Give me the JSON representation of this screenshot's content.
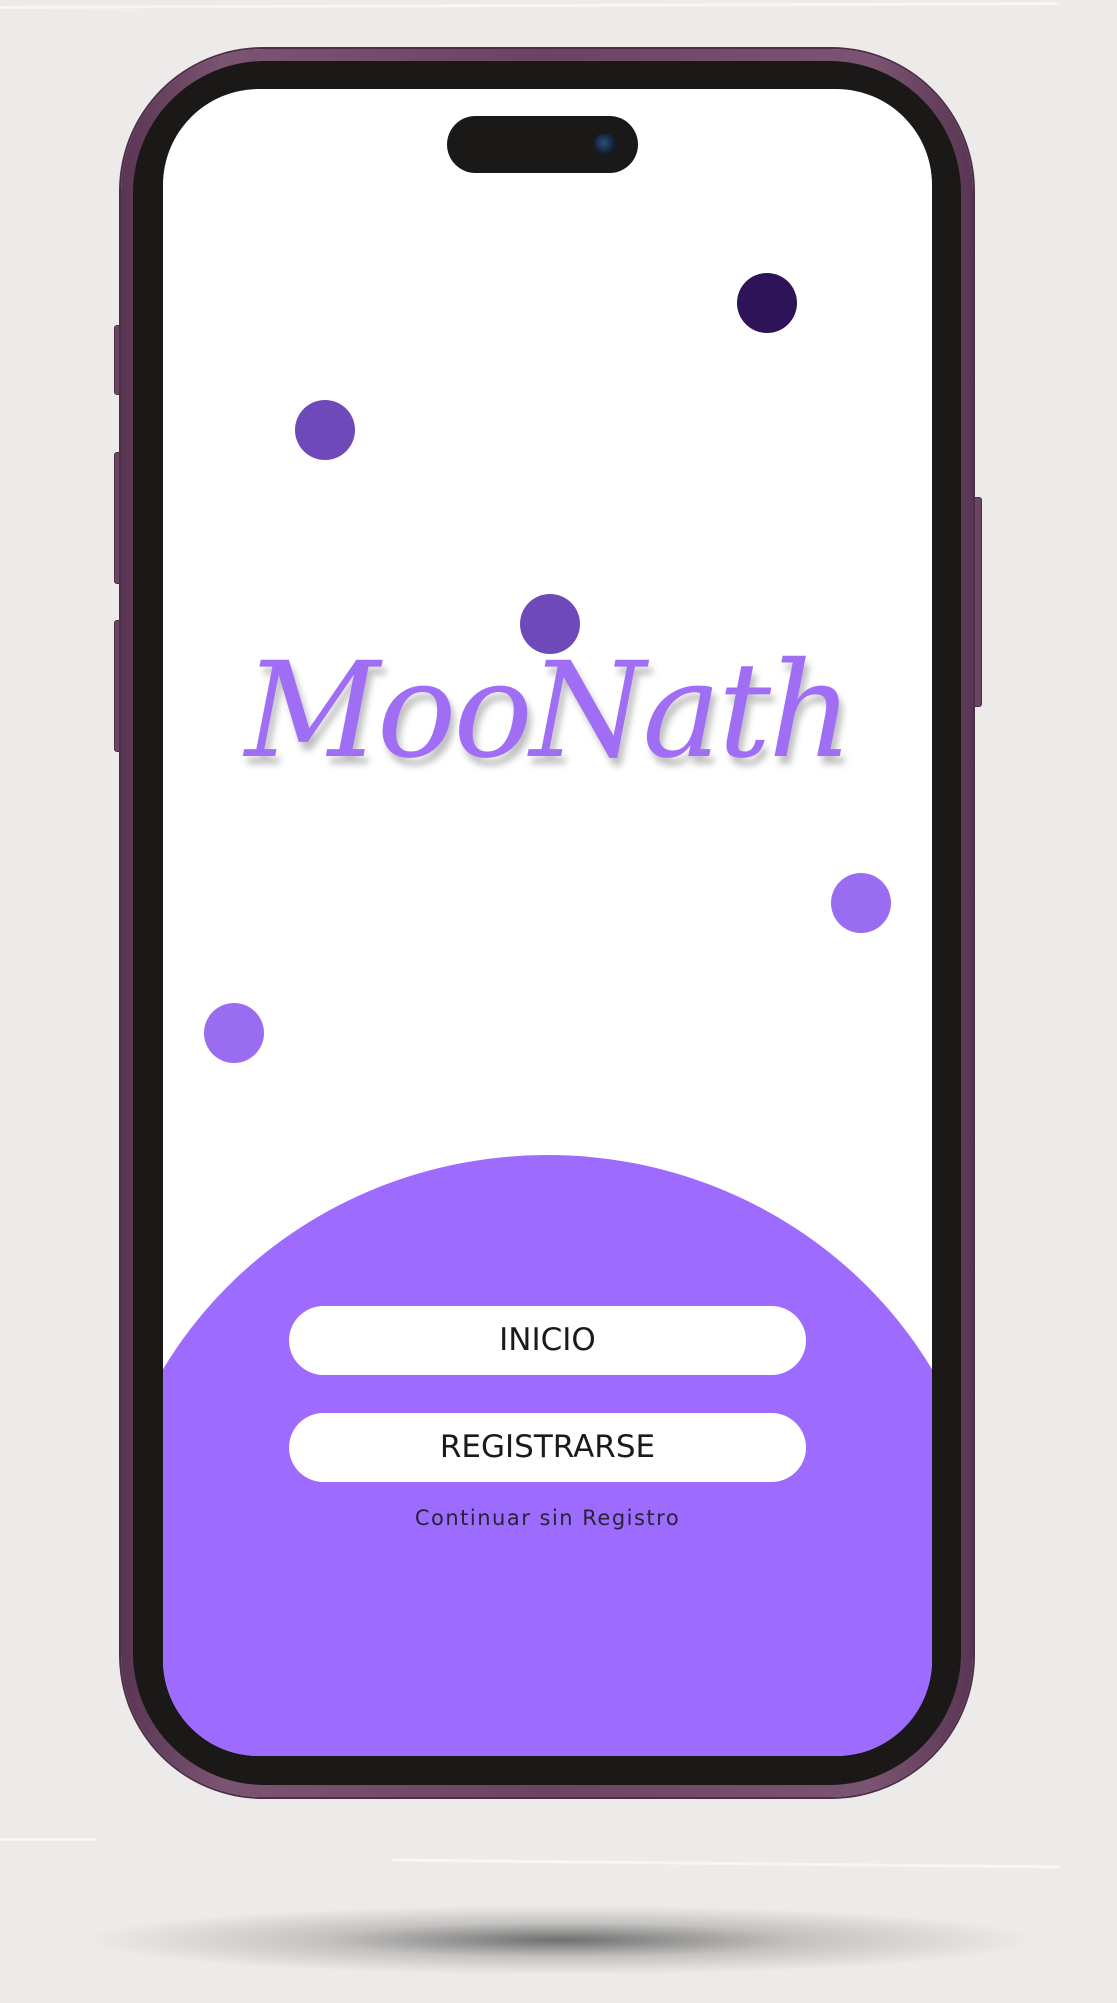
{
  "app": {
    "logo_text": "MooNath"
  },
  "actions": {
    "login_label": "INICIO",
    "register_label": "REGISTRARSE",
    "guest_label": "Continuar sin Registro"
  },
  "colors": {
    "brand_purple": "#9d6bfe",
    "logo_purple": "#a06df5",
    "dot_dark": "#2e1358",
    "dot_medium": "#6e49b9",
    "dot_light": "#9a6cf2",
    "phone_frame": "#6a4462",
    "background": "#edebe9"
  },
  "icons": {
    "front_camera": "front-camera-icon"
  }
}
